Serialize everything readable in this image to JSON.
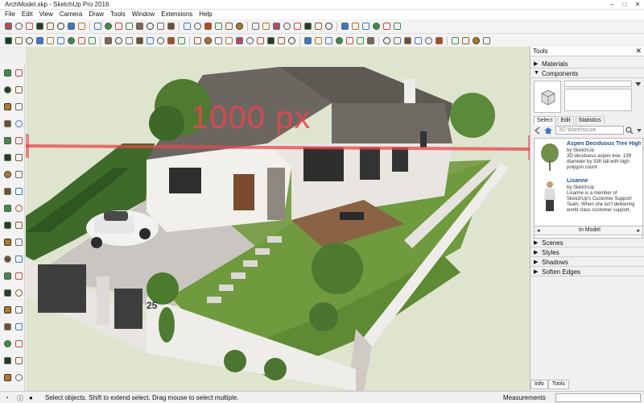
{
  "window": {
    "title": "ArchModel.skp - SketchUp Pro 2016",
    "controls": [
      "–",
      "□",
      "✕"
    ]
  },
  "menu": [
    "File",
    "Edit",
    "View",
    "Camera",
    "Draw",
    "Tools",
    "Window",
    "Extensions",
    "Help"
  ],
  "viewport": {
    "measure_label": "1000 px",
    "house_number": "25"
  },
  "tray": {
    "title": "Tools",
    "sections": {
      "materials": "Materials",
      "components": "Components",
      "scenes": "Scenes",
      "styles": "Styles",
      "shadows": "Shadows",
      "soften": "Soften Edges"
    },
    "component_tabs": [
      "Select",
      "Edit",
      "Statistics"
    ],
    "search_placeholder": "3D Warehouse",
    "items": [
      {
        "title": "Aspen Deciduous Tree High Pol…",
        "author": "by SketchUp",
        "desc": "3D deciduous aspen tree. 15ft diameter by 33ft tall with high polygon count"
      },
      {
        "title": "Lisanne",
        "author": "by SketchUp",
        "desc": "Lisanne is a member of SketchUp's Customer Support Team. When she isn't delivering world class customer support,"
      }
    ],
    "in_model": "In Model",
    "bottom_tabs": [
      "Info",
      "Tools"
    ]
  },
  "status": {
    "text": "Select objects. Shift to extend select. Drag mouse to select multiple.",
    "measurements_label": "Measurements"
  },
  "colors": {
    "measure_line": "#e8454c",
    "accent_blue": "#1d6fc1",
    "roof": "#6b6660"
  },
  "icons": {
    "toolbar": [
      "select-icon",
      "eraser-icon",
      "paint-bucket-icon",
      "component-icon",
      "group-icon",
      "home-icon",
      "warehouse-icon",
      "extension-warehouse-icon",
      "layout-icon",
      "push-pull-icon",
      "follow-me-icon",
      "offset-icon",
      "move-icon",
      "rotate-icon",
      "scale-icon",
      "tape-measure-icon",
      "text-icon",
      "axes-icon",
      "orbit-icon",
      "pan-icon",
      "zoom-icon",
      "zoom-extents-icon",
      "iso-view-icon",
      "top-view-icon",
      "front-view-icon",
      "right-view-icon",
      "back-view-icon",
      "left-view-icon",
      "xray-icon",
      "back-edges-icon",
      "wireframe-icon",
      "hidden-line-icon",
      "shaded-icon",
      "textured-icon",
      "monochrome-icon",
      "geolocate-icon",
      "add-location-icon",
      "terrain-icon",
      "section-plane-icon",
      "display-section-icon",
      "section-cuts-icon",
      "walk-icon",
      "look-around-icon",
      "position-camera-icon",
      "share-model-icon",
      "ruby-console-icon"
    ]
  }
}
